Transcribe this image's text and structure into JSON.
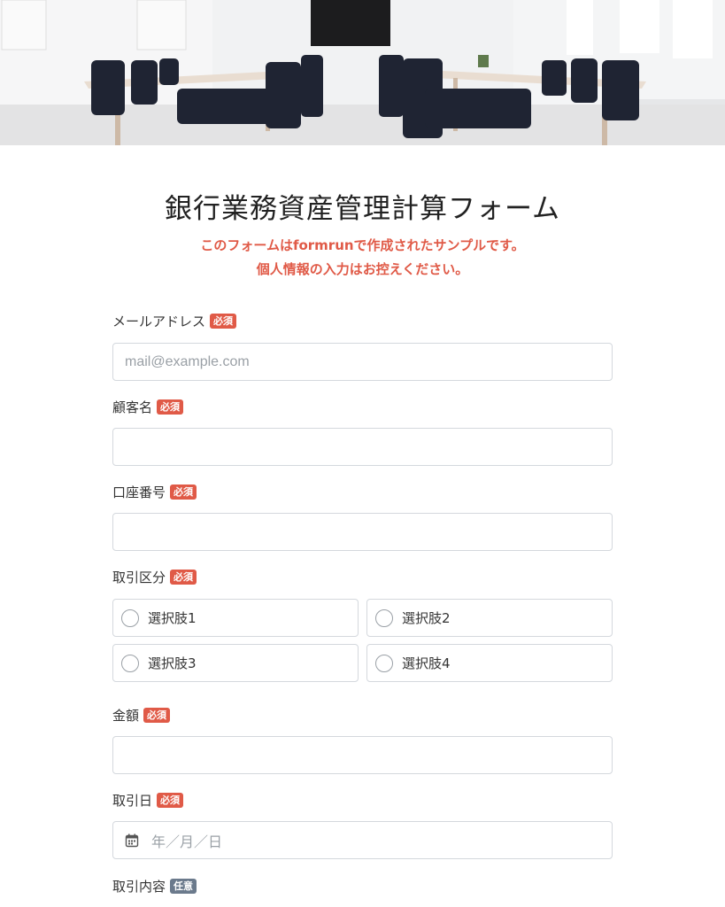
{
  "form": {
    "title": "銀行業務資産管理計算フォーム",
    "notice_line1": "このフォームはformrunで作成されたサンプルです。",
    "notice_line2": "個人情報の入力はお控えください。"
  },
  "badges": {
    "required": "必須",
    "optional": "任意"
  },
  "fields": {
    "email": {
      "label": "メールアドレス",
      "placeholder": "mail@example.com"
    },
    "customer_name": {
      "label": "顧客名",
      "value": ""
    },
    "account_number": {
      "label": "口座番号",
      "value": ""
    },
    "transaction_type": {
      "label": "取引区分",
      "options": [
        "選択肢1",
        "選択肢2",
        "選択肢3",
        "選択肢4"
      ]
    },
    "amount": {
      "label": "金額",
      "value": ""
    },
    "transaction_date": {
      "label": "取引日",
      "placeholder": "年／月／日",
      "icon": "calendar-icon"
    },
    "transaction_details": {
      "label": "取引内容"
    }
  },
  "colors": {
    "accent_red": "#e05a47",
    "optional_gray": "#6b7a8c",
    "border": "#d4d8dd"
  }
}
